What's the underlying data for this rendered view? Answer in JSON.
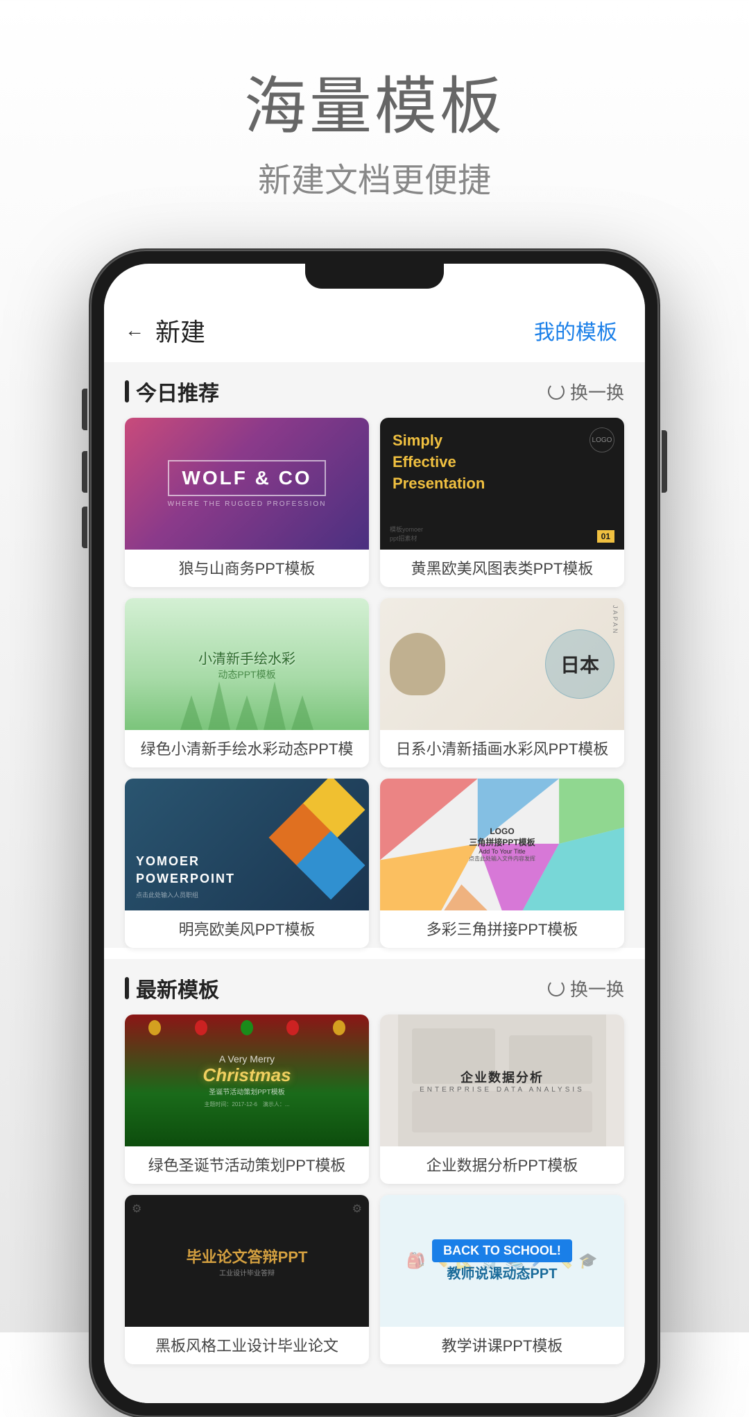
{
  "page": {
    "title": "海量模板",
    "subtitle": "新建文档更便捷"
  },
  "app": {
    "topbar": {
      "back_label": "←",
      "title": "新建",
      "my_templates": "我的模板"
    },
    "today_section": {
      "title": "今日推荐",
      "refresh": "换一换"
    },
    "latest_section": {
      "title": "最新模板",
      "refresh": "换一换"
    },
    "today_templates": [
      {
        "id": "wolf",
        "title": "WOLF & CO",
        "subtitle": "狼与山商务PPT模板",
        "type": "wolf"
      },
      {
        "id": "effective",
        "title": "Simply Effective Presentation",
        "subtitle": "黄黑欧美风图表类PPT模板",
        "type": "effective"
      },
      {
        "id": "watercolor",
        "title": "小清新手绘水彩",
        "subtitle": "绿色小清新手绘水彩动态PPT模",
        "type": "watercolor"
      },
      {
        "id": "japan",
        "title": "日本",
        "subtitle": "日系小清新插画水彩风PPT模板",
        "type": "japan"
      },
      {
        "id": "yomoer",
        "title": "YOMOER POWERPOINT",
        "subtitle": "明亮欧美风PPT模板",
        "type": "yomoer"
      },
      {
        "id": "triangle",
        "title": "三角拼接PPT模板",
        "subtitle": "多彩三角拼接PPT模板",
        "type": "triangle"
      }
    ],
    "latest_templates": [
      {
        "id": "christmas",
        "title": "CHRISTMAS",
        "subtitle": "绿色圣诞节活动策划PPT模板",
        "type": "christmas"
      },
      {
        "id": "bizdata",
        "title": "企业数据分析",
        "subtitle": "企业数据分析PPT模板",
        "type": "bizdata"
      },
      {
        "id": "thesis",
        "title": "毕业论文答辩PPT",
        "subtitle": "黑板风格工业设计毕业论文",
        "type": "thesis"
      },
      {
        "id": "teacher",
        "title": "教师说课动态PPT",
        "subtitle": "教学讲课PPT模板",
        "type": "teacher"
      }
    ]
  }
}
